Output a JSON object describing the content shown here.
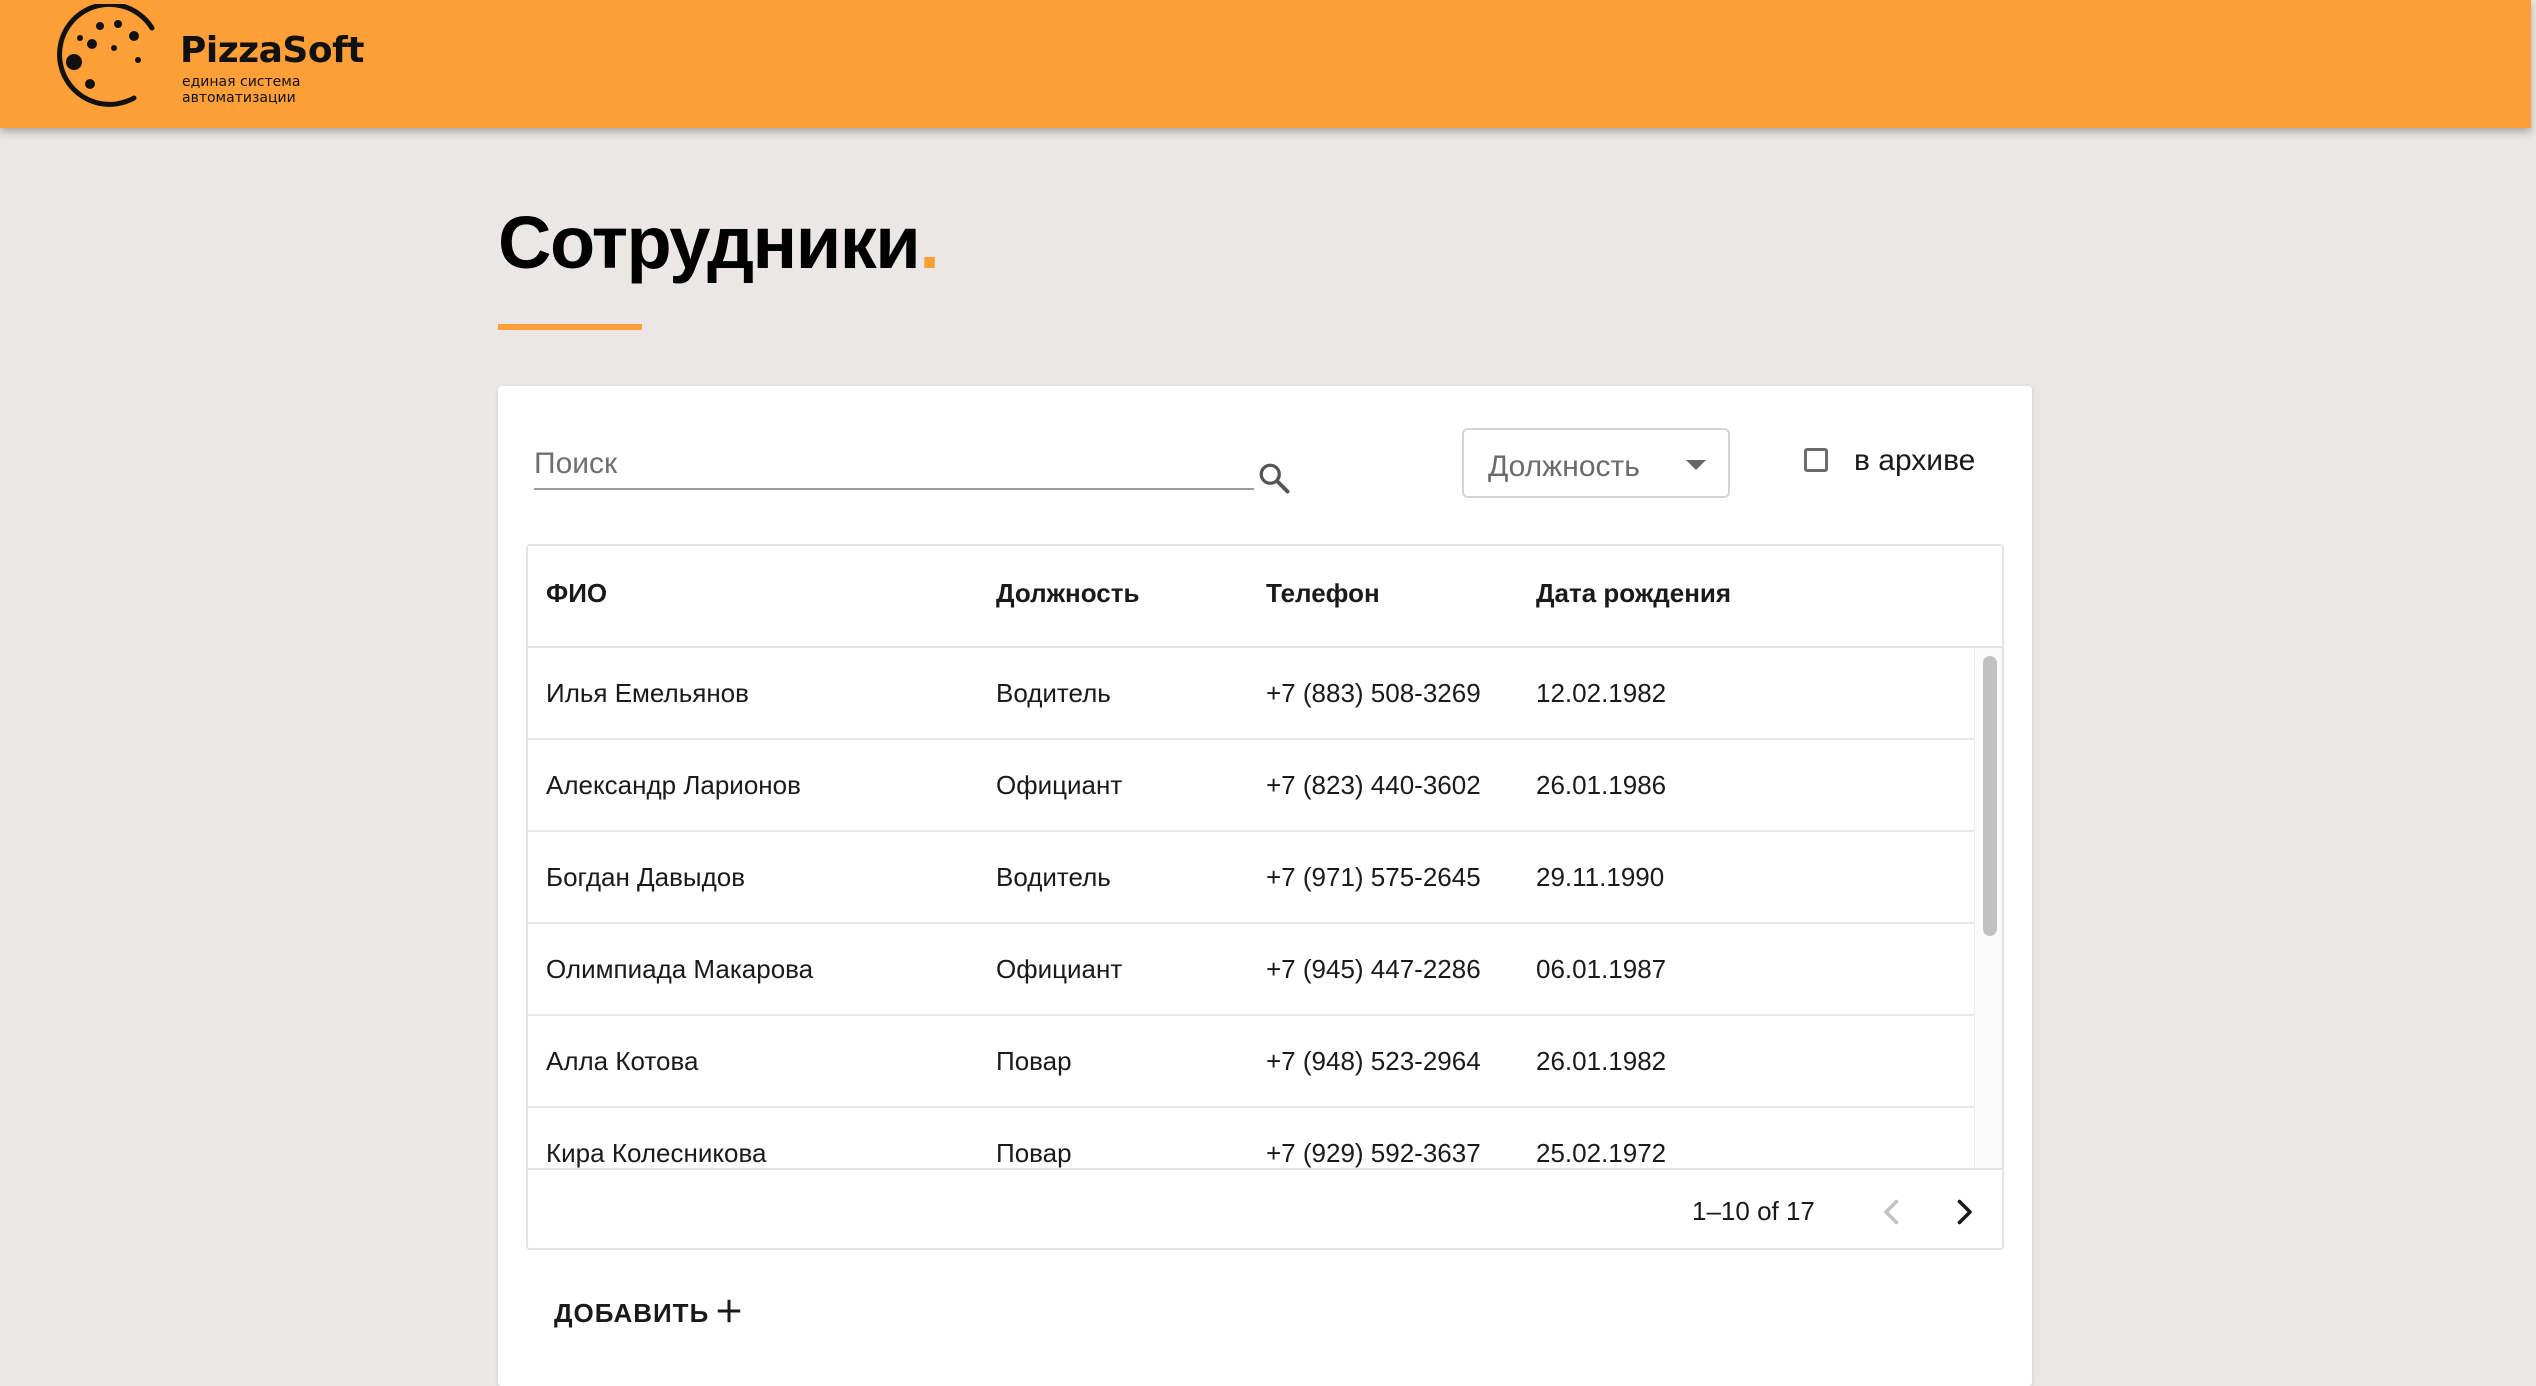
{
  "brand": {
    "name": "PizzaSoft",
    "tagline_line1": "единая система",
    "tagline_line2": "автоматизации",
    "accent_color": "#FF9F38"
  },
  "page": {
    "title": "Сотрудники",
    "title_dot": "."
  },
  "filters": {
    "search_placeholder": "Поиск",
    "position_placeholder": "Должность",
    "archive_label": "в архиве",
    "archive_checked": false
  },
  "table": {
    "headers": {
      "name": "ФИО",
      "position": "Должность",
      "phone": "Телефон",
      "birthdate": "Дата рождения"
    },
    "rows": [
      {
        "name": "Илья Емельянов",
        "position": "Водитель",
        "phone": "+7 (883) 508-3269",
        "birthdate": "12.02.1982"
      },
      {
        "name": "Александр Ларионов",
        "position": "Официант",
        "phone": "+7 (823) 440-3602",
        "birthdate": "26.01.1986"
      },
      {
        "name": "Богдан Давыдов",
        "position": "Водитель",
        "phone": "+7 (971) 575-2645",
        "birthdate": "29.11.1990"
      },
      {
        "name": "Олимпиада Макарова",
        "position": "Официант",
        "phone": "+7 (945) 447-2286",
        "birthdate": "06.01.1987"
      },
      {
        "name": "Алла Котова",
        "position": "Повар",
        "phone": "+7 (948) 523-2964",
        "birthdate": "26.01.1982"
      },
      {
        "name": "Кира Колесникова",
        "position": "Повар",
        "phone": "+7 (929) 592-3637",
        "birthdate": "25.02.1972"
      }
    ]
  },
  "pagination": {
    "info": "1–10 of 17"
  },
  "actions": {
    "add_label": "ДОБАВИТЬ"
  },
  "icons": {
    "logo": "pizza-logo-icon",
    "search": "search-icon",
    "dropdown": "caret-down-icon",
    "checkbox": "checkbox-icon",
    "prev": "chevron-left-icon",
    "next": "chevron-right-icon",
    "add": "plus-icon"
  }
}
